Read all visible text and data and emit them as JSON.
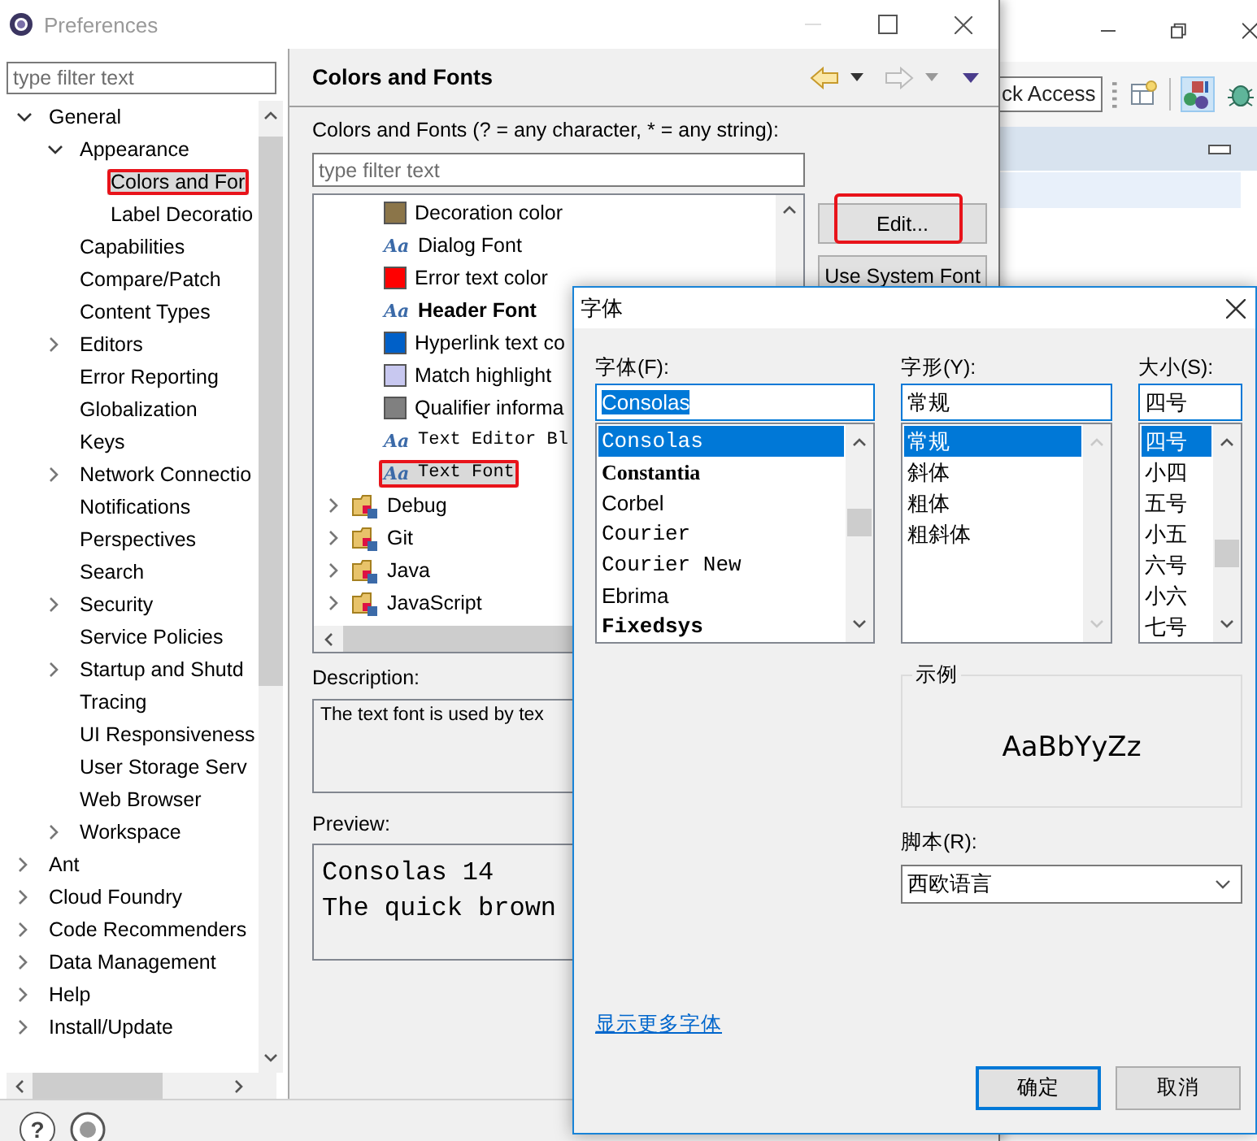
{
  "background_window": {
    "quick_access": "ck Access",
    "toolbar": [
      {
        "kind": "grid",
        "selected": false
      },
      {
        "kind": "shapes",
        "selected": true
      },
      {
        "kind": "bug",
        "selected": false
      }
    ]
  },
  "preferences": {
    "title": "Preferences",
    "filter": {
      "placeholder": "type filter text"
    },
    "tree": [
      {
        "label": "General",
        "expanded": true,
        "selected": false,
        "children": [
          {
            "label": "Appearance",
            "expanded": true,
            "selected": false,
            "children": [
              {
                "label": "Colors and For",
                "selected": true,
                "highlighted": true
              },
              {
                "label": "Label Decoratio",
                "selected": false
              }
            ]
          },
          {
            "label": "Capabilities",
            "selected": false
          },
          {
            "label": "Compare/Patch",
            "selected": false
          },
          {
            "label": "Content Types",
            "selected": false
          },
          {
            "label": "Editors",
            "expanded": false,
            "selected": false
          },
          {
            "label": "Error Reporting",
            "selected": false
          },
          {
            "label": "Globalization",
            "selected": false
          },
          {
            "label": "Keys",
            "selected": false
          },
          {
            "label": "Network Connectio",
            "expanded": false,
            "selected": false
          },
          {
            "label": "Notifications",
            "selected": false
          },
          {
            "label": "Perspectives",
            "selected": false
          },
          {
            "label": "Search",
            "selected": false
          },
          {
            "label": "Security",
            "expanded": false,
            "selected": false
          },
          {
            "label": "Service Policies",
            "selected": false
          },
          {
            "label": "Startup and Shutd",
            "expanded": false,
            "selected": false
          },
          {
            "label": "Tracing",
            "selected": false
          },
          {
            "label": "UI Responsiveness",
            "selected": false
          },
          {
            "label": "User Storage Serv",
            "selected": false
          },
          {
            "label": "Web Browser",
            "selected": false
          },
          {
            "label": "Workspace",
            "expanded": false,
            "selected": false
          }
        ]
      },
      {
        "label": "Ant",
        "expanded": false,
        "selected": false
      },
      {
        "label": "Cloud Foundry",
        "expanded": false,
        "selected": false
      },
      {
        "label": "Code Recommenders",
        "expanded": false,
        "selected": false
      },
      {
        "label": "Data Management",
        "expanded": false,
        "selected": false
      },
      {
        "label": "Help",
        "expanded": false,
        "selected": false
      },
      {
        "label": "Install/Update",
        "expanded": false,
        "selected": false
      }
    ],
    "help_button": "?",
    "page": {
      "title": "Colors and Fonts",
      "filter_label": "Colors and Fonts (? = any character, * = any string):",
      "filter": {
        "placeholder": "type filter text"
      },
      "items": [
        {
          "kind": "color",
          "label": "Decoration color",
          "color": "#8b7549",
          "selected": false
        },
        {
          "kind": "font",
          "label": "Dialog Font",
          "icon": "Aa",
          "selected": false
        },
        {
          "kind": "color",
          "label": "Error text color",
          "color": "#ff0000",
          "selected": false
        },
        {
          "kind": "boldfont",
          "label": "Header Font",
          "icon": "Aa",
          "selected": false
        },
        {
          "kind": "color",
          "label": "Hyperlink text co",
          "color": "#0060c8",
          "selected": false
        },
        {
          "kind": "color",
          "label": "Match highlight",
          "color": "#c8c8f0",
          "selected": false
        },
        {
          "kind": "color",
          "label": "Qualifier informa",
          "color": "#808080",
          "selected": false
        },
        {
          "kind": "monofont",
          "label": "Text Editor Bl",
          "icon": "Aa",
          "selected": false
        },
        {
          "kind": "monofont",
          "label": "Text Font",
          "icon": "Aa",
          "selected": true,
          "highlighted": true
        },
        {
          "kind": "category",
          "label": "Debug",
          "expanded": false,
          "selected": false
        },
        {
          "kind": "category",
          "label": "Git",
          "expanded": false,
          "selected": false
        },
        {
          "kind": "category",
          "label": "Java",
          "expanded": false,
          "selected": false
        },
        {
          "kind": "category",
          "label": "JavaScript",
          "expanded": false,
          "selected": false
        }
      ],
      "buttons": [
        {
          "label": "Edit...",
          "highlighted": true
        },
        {
          "label": "Use System Font"
        }
      ],
      "description_label": "Description:",
      "description": "The text font is used by tex",
      "preview_label": "Preview:",
      "preview": [
        "Consolas 14",
        "The quick brown"
      ]
    }
  },
  "font_dialog": {
    "title": "字体",
    "font": {
      "label": "字体(F):",
      "value": "Consolas",
      "value_selected": true,
      "options": [
        {
          "label": "Consolas",
          "kind": "mono",
          "selected": true
        },
        {
          "label": "Constantia",
          "kind": "serifbold",
          "selected": false
        },
        {
          "label": "Corbel",
          "kind": "sans",
          "selected": false
        },
        {
          "label": "Courier",
          "kind": "mono",
          "selected": false
        },
        {
          "label": "Courier New",
          "kind": "mono",
          "selected": false
        },
        {
          "label": "Ebrima",
          "kind": "sans",
          "selected": false
        },
        {
          "label": "Fixedsys",
          "kind": "monobold",
          "selected": false
        }
      ]
    },
    "style": {
      "label": "字形(Y):",
      "value": "常规",
      "value_selected": false,
      "options": [
        {
          "label": "常规",
          "selected": true
        },
        {
          "label": "斜体",
          "selected": false
        },
        {
          "label": "粗体",
          "selected": false
        },
        {
          "label": "粗斜体",
          "selected": false
        }
      ]
    },
    "size": {
      "label": "大小(S):",
      "value": "四号",
      "value_selected": false,
      "options": [
        {
          "label": "四号",
          "selected": true
        },
        {
          "label": "小四",
          "selected": false
        },
        {
          "label": "五号",
          "selected": false
        },
        {
          "label": "小五",
          "selected": false
        },
        {
          "label": "六号",
          "selected": false
        },
        {
          "label": "小六",
          "selected": false
        },
        {
          "label": "七号",
          "selected": false
        }
      ]
    },
    "sample": {
      "label": "示例",
      "text": "AaBbYyZz"
    },
    "script": {
      "label": "脚本(R):",
      "value": "西欧语言"
    },
    "more_fonts_link": "显示更多字体",
    "buttons": [
      {
        "label": "确定",
        "default": true
      },
      {
        "label": "取消",
        "default": false
      }
    ]
  }
}
